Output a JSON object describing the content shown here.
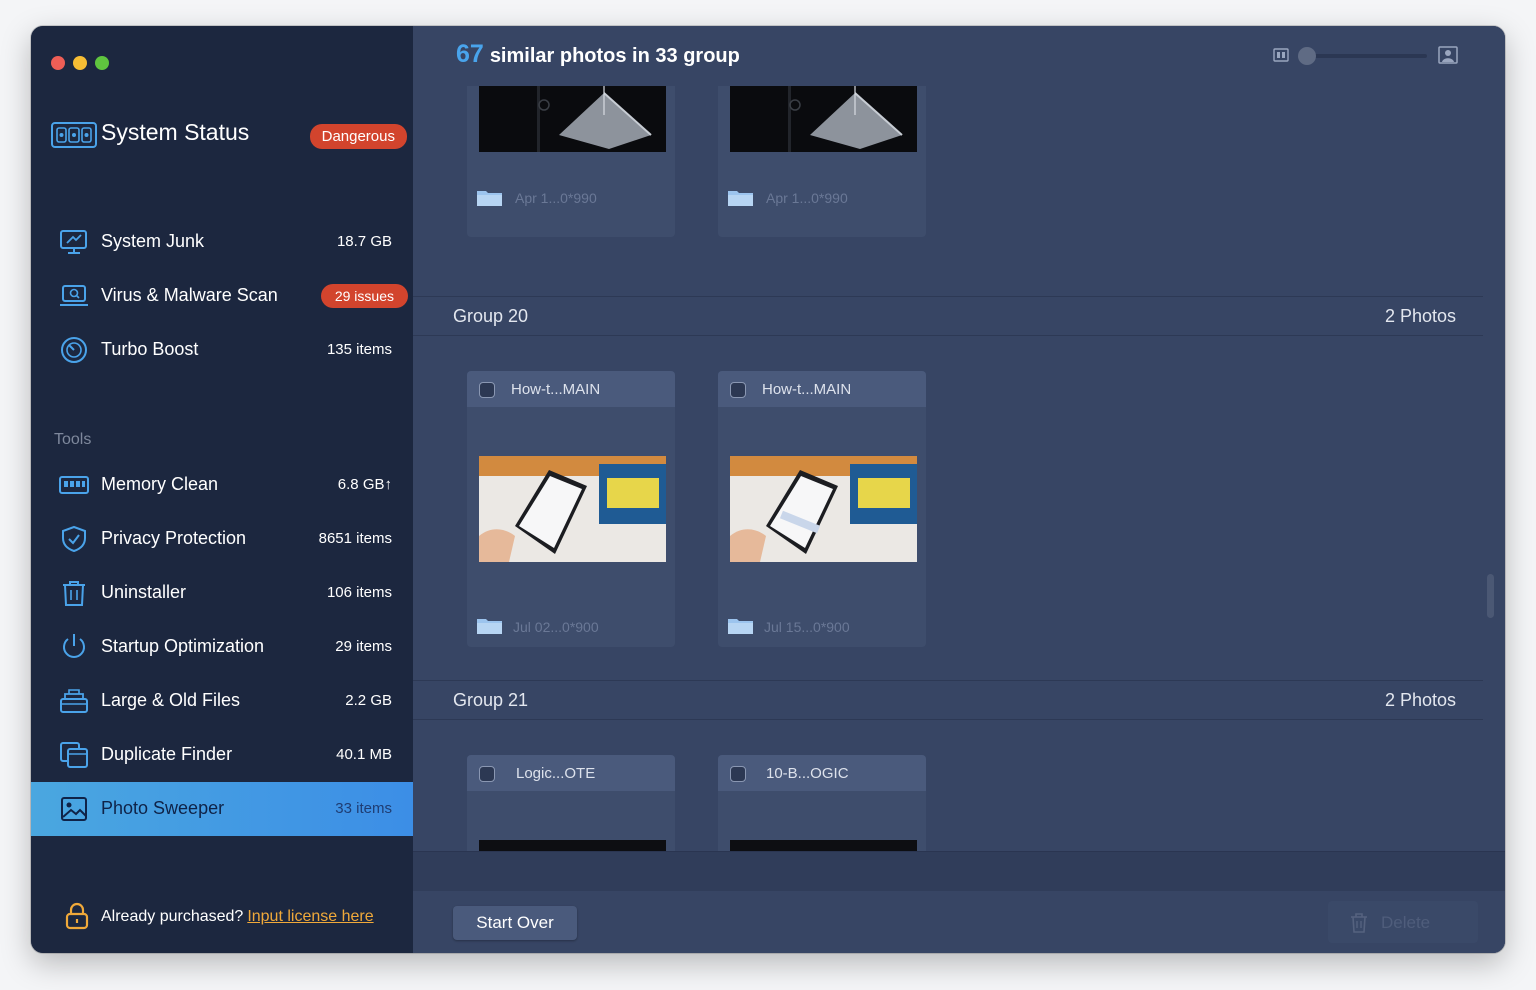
{
  "window": {
    "traffic_lights": [
      "close",
      "minimize",
      "zoom"
    ]
  },
  "sidebar": {
    "status": {
      "title": "System Status",
      "badge": "Dangerous"
    },
    "main_items": [
      {
        "label": "System Junk",
        "value": "18.7 GB",
        "icon": "monitor-icon"
      },
      {
        "label": "Virus & Malware Scan",
        "value": "29 issues",
        "icon": "laptop-scan-icon"
      },
      {
        "label": "Turbo Boost",
        "value": "135 items",
        "icon": "gauge-icon"
      }
    ],
    "tools_label": "Tools",
    "tool_items": [
      {
        "label": "Memory Clean",
        "value": "6.8 GB↑",
        "icon": "memory-icon"
      },
      {
        "label": "Privacy Protection",
        "value": "8651 items",
        "icon": "shield-icon"
      },
      {
        "label": "Uninstaller",
        "value": "106 items",
        "icon": "trash-icon"
      },
      {
        "label": "Startup Optimization",
        "value": "29 items",
        "icon": "power-icon"
      },
      {
        "label": "Large & Old Files",
        "value": "2.2 GB",
        "icon": "files-stack-icon"
      },
      {
        "label": "Duplicate Finder",
        "value": "40.1 MB",
        "icon": "duplicate-icon"
      },
      {
        "label": "Photo Sweeper",
        "value": "33 items",
        "icon": "photo-icon"
      }
    ],
    "license": {
      "prefix": "Already purchased?",
      "link": "Input license here"
    }
  },
  "main": {
    "header": {
      "count": "67",
      "text": "similar photos in 33 group"
    },
    "groups": [
      {
        "name": "",
        "count": "",
        "photos": [
          {
            "filename": "",
            "meta": "Apr 1...0*990"
          },
          {
            "filename": "",
            "meta": "Apr 1...0*990"
          }
        ]
      },
      {
        "name": "Group 20",
        "count": "2 Photos",
        "photos": [
          {
            "filename": "How-t...MAIN",
            "meta": "Jul 02...0*900"
          },
          {
            "filename": "How-t...MAIN",
            "meta": "Jul 15...0*900"
          }
        ]
      },
      {
        "name": "Group 21",
        "count": "2 Photos",
        "photos": [
          {
            "filename": "Logic...OTE",
            "meta": ""
          },
          {
            "filename": "10-B...OGIC",
            "meta": ""
          }
        ]
      }
    ],
    "footer": {
      "start_over": "Start Over",
      "delete": "Delete"
    }
  }
}
